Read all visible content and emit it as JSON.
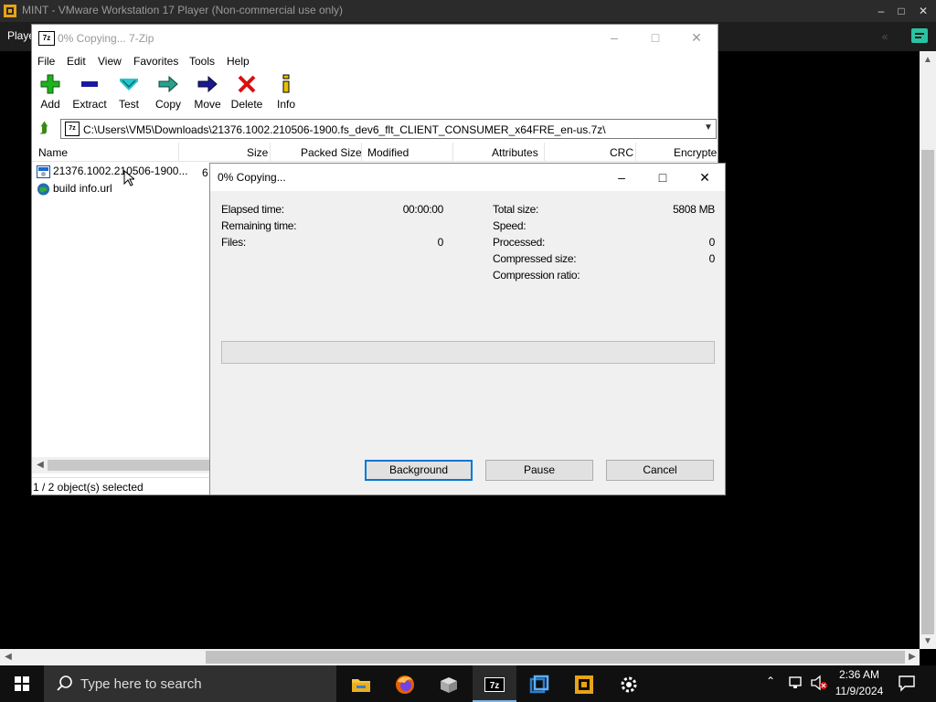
{
  "vmware": {
    "title": "MINT - VMware Workstation 17 Player (Non-commercial use only)",
    "player_label": "Playe",
    "minimize": "–",
    "maximize": "□",
    "close": "✕"
  },
  "sevenzip": {
    "title": "0% Copying... 7-Zip",
    "icon_text": "7z",
    "menu": [
      "File",
      "Edit",
      "View",
      "Favorites",
      "Tools",
      "Help"
    ],
    "toolbar": [
      {
        "label": "Add",
        "icon": "add-icon"
      },
      {
        "label": "Extract",
        "icon": "extract-icon"
      },
      {
        "label": "Test",
        "icon": "test-icon"
      },
      {
        "label": "Copy",
        "icon": "copy-icon"
      },
      {
        "label": "Move",
        "icon": "move-icon"
      },
      {
        "label": "Delete",
        "icon": "delete-icon"
      },
      {
        "label": "Info",
        "icon": "info-icon"
      }
    ],
    "address": "C:\\Users\\VM5\\Downloads\\21376.1002.210506-1900.fs_dev6_flt_CLIENT_CONSUMER_x64FRE_en-us.7z\\",
    "columns": [
      "Name",
      "Size",
      "Packed Size",
      "Modified",
      "Attributes",
      "CRC",
      "Encrypte"
    ],
    "files": [
      {
        "name": "21376.1002.210506-1900...",
        "size_fragment": "6",
        "icon": "iso-file-icon"
      },
      {
        "name": "build info.url",
        "icon": "url-file-icon"
      }
    ],
    "status": "1 / 2 object(s) selected"
  },
  "dialog": {
    "title": "0% Copying...",
    "left_stats": [
      {
        "label": "Elapsed time:",
        "value": "00:00:00"
      },
      {
        "label": "Remaining time:",
        "value": ""
      },
      {
        "label": "Files:",
        "value": "0"
      }
    ],
    "right_stats": [
      {
        "label": "Total size:",
        "value": "5808 MB"
      },
      {
        "label": "Speed:",
        "value": ""
      },
      {
        "label": "Processed:",
        "value": "0"
      },
      {
        "label": "Compressed size:",
        "value": "0"
      },
      {
        "label": "Compression ratio:",
        "value": ""
      }
    ],
    "progress_percent": 0,
    "buttons": {
      "background": "Background",
      "pause": "Pause",
      "cancel": "Cancel"
    }
  },
  "taskbar": {
    "search_placeholder": "Type here to search",
    "apps": [
      "file-explorer-icon",
      "firefox-icon",
      "package-icon",
      "7zip-icon",
      "virtualbox-icon",
      "vmware-icon",
      "settings-icon"
    ],
    "active_app": "7zip-icon",
    "time": "2:36 AM",
    "date": "11/9/2024"
  },
  "colors": {
    "accent": "#0078d7",
    "progress": "#06b025",
    "taskbar": "#101010"
  }
}
